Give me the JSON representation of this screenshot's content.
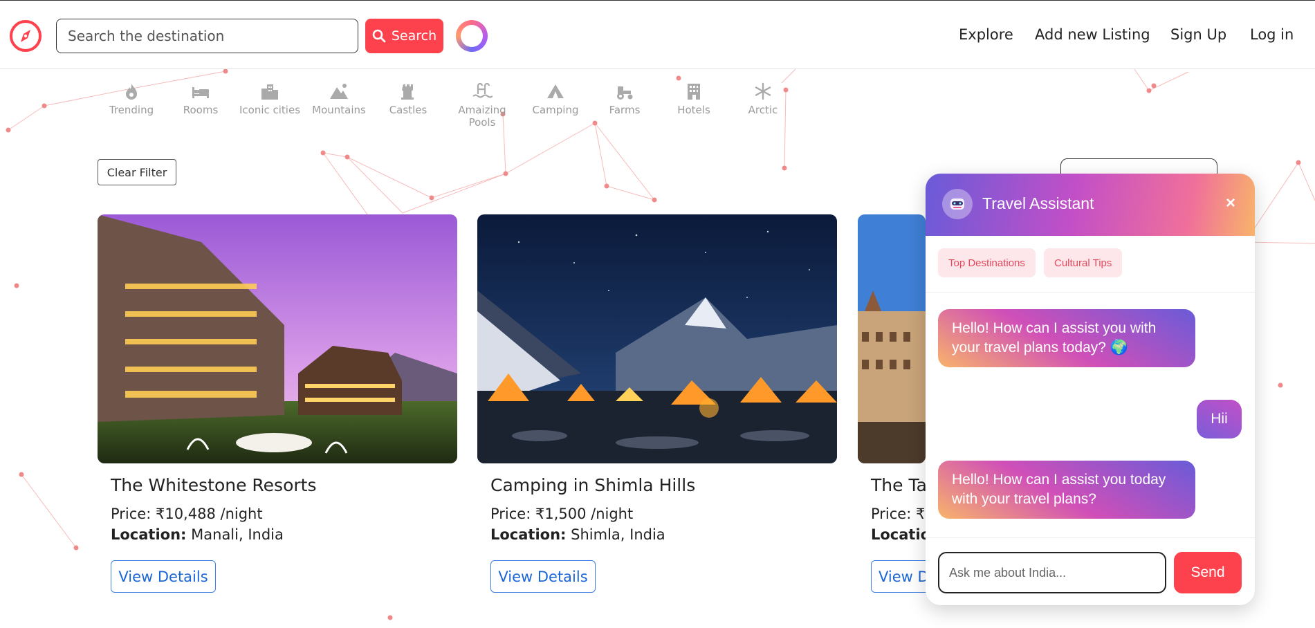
{
  "nav": {
    "search_placeholder": "Search the destination",
    "search_label": "Search",
    "links": [
      "Explore",
      "Add new Listing",
      "Sign Up",
      "Log in"
    ]
  },
  "filters": [
    {
      "label": "Trending",
      "icon": "fire-icon"
    },
    {
      "label": "Rooms",
      "icon": "bed-icon"
    },
    {
      "label": "Iconic cities",
      "icon": "city-icon"
    },
    {
      "label": "Mountains",
      "icon": "mountain-icon"
    },
    {
      "label": "Castles",
      "icon": "castle-icon"
    },
    {
      "label": "Amaizing Pools",
      "icon": "pool-icon"
    },
    {
      "label": "Camping",
      "icon": "tent-icon"
    },
    {
      "label": "Farms",
      "icon": "tractor-icon"
    },
    {
      "label": "Hotels",
      "icon": "hotel-icon"
    },
    {
      "label": "Arctic",
      "icon": "snowflake-icon"
    }
  ],
  "clear_filter_label": "Clear Filter",
  "listings": [
    {
      "title": "The Whitestone Resorts",
      "price": "Price: ₹10,488 /night",
      "location_label": "Location:",
      "location": "Manali, India",
      "button": "View Details"
    },
    {
      "title": "Camping in Shimla Hills",
      "price": "Price: ₹1,500 /night",
      "location_label": "Location:",
      "location": "Shimla, India",
      "button": "View Details"
    },
    {
      "title": "The Ta",
      "price": "Price: ₹1",
      "location_label": "Locatio",
      "location": "",
      "button": "View D"
    }
  ],
  "chat": {
    "title": "Travel Assistant",
    "close": "×",
    "chips": [
      "Top Destinations",
      "Cultural Tips"
    ],
    "messages": [
      {
        "from": "bot",
        "text": "Hello! How can I assist you with your travel plans today? 🌍"
      },
      {
        "from": "user",
        "text": "Hii"
      },
      {
        "from": "bot",
        "text": "Hello! How can I assist you today with your travel plans?"
      }
    ],
    "input_placeholder": "Ask me about India...",
    "send_label": "Send"
  },
  "colors": {
    "brand": "#fe424d",
    "link": "#1a66d6"
  }
}
